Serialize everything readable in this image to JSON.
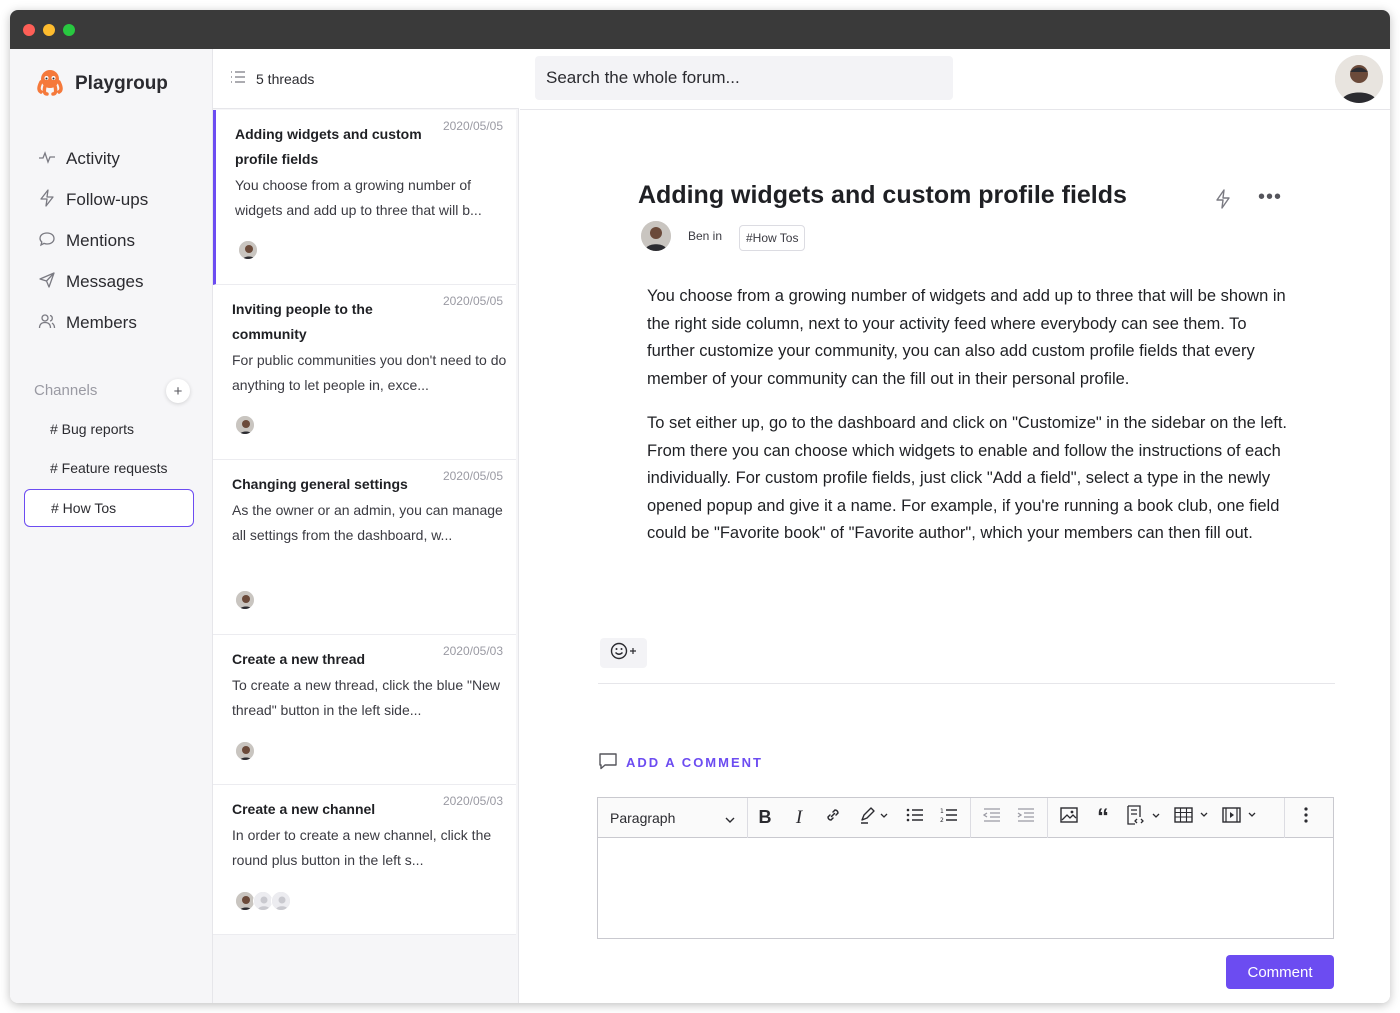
{
  "app": {
    "name": "Playgroup",
    "accent": "#6c4cf1"
  },
  "nav": [
    {
      "label": "Activity",
      "icon": "activity-icon"
    },
    {
      "label": "Follow-ups",
      "icon": "bolt-icon"
    },
    {
      "label": "Mentions",
      "icon": "chat-bubble-icon"
    },
    {
      "label": "Messages",
      "icon": "send-icon"
    },
    {
      "label": "Members",
      "icon": "people-icon"
    }
  ],
  "channels": {
    "label": "Channels",
    "add": "+",
    "items": [
      "# Bug reports",
      "# Feature requests",
      "# How Tos"
    ],
    "active": "# How Tos"
  },
  "threads": {
    "count_label": "5 threads",
    "items": [
      {
        "title": "Adding widgets and custom profile fields",
        "date": "2020/05/05",
        "excerpt": "You choose from a growing number of widgets and add up to three that will b...",
        "active": true
      },
      {
        "title": "Inviting people to the community",
        "date": "2020/05/05",
        "excerpt": "For public communities you don't need to do anything to let people in, exce..."
      },
      {
        "title": "Changing general settings",
        "date": "2020/05/05",
        "excerpt": "As the owner or an admin, you can manage all settings from the dashboard, w..."
      },
      {
        "title": "Create a new thread",
        "date": "2020/05/03",
        "excerpt": "To create a new thread, click the blue \"New thread\" button in the left side..."
      },
      {
        "title": "Create a new channel",
        "date": "2020/05/03",
        "excerpt": "In order to create a new channel, click the round plus button in the left s..."
      }
    ]
  },
  "search": {
    "placeholder": "Search the whole forum..."
  },
  "post": {
    "title": "Adding widgets and custom profile fields",
    "author_line": "Ben in",
    "tag": "#How Tos",
    "paragraphs": [
      "You choose from a growing number of widgets and add up to three that will be shown in the right side column, next to your activity feed where everybody can see them. To further customize your community, you can also add custom profile fields that every member of your community can the fill out in their personal profile.",
      "To set either up, go to the dashboard and click on \"Customize\" in the sidebar on the left. From there you can choose which widgets to enable and follow the instructions of each individually. For custom profile fields, just click \"Add a field\", select a type in the newly opened popup and give it a name. For example, if you're running a book club, one field could be \"Favorite book\" of \"Favorite author\", which your members can then fill out."
    ]
  },
  "comment": {
    "add_label": "ADD A COMMENT",
    "format_select": "Paragraph",
    "submit_label": "Comment"
  }
}
